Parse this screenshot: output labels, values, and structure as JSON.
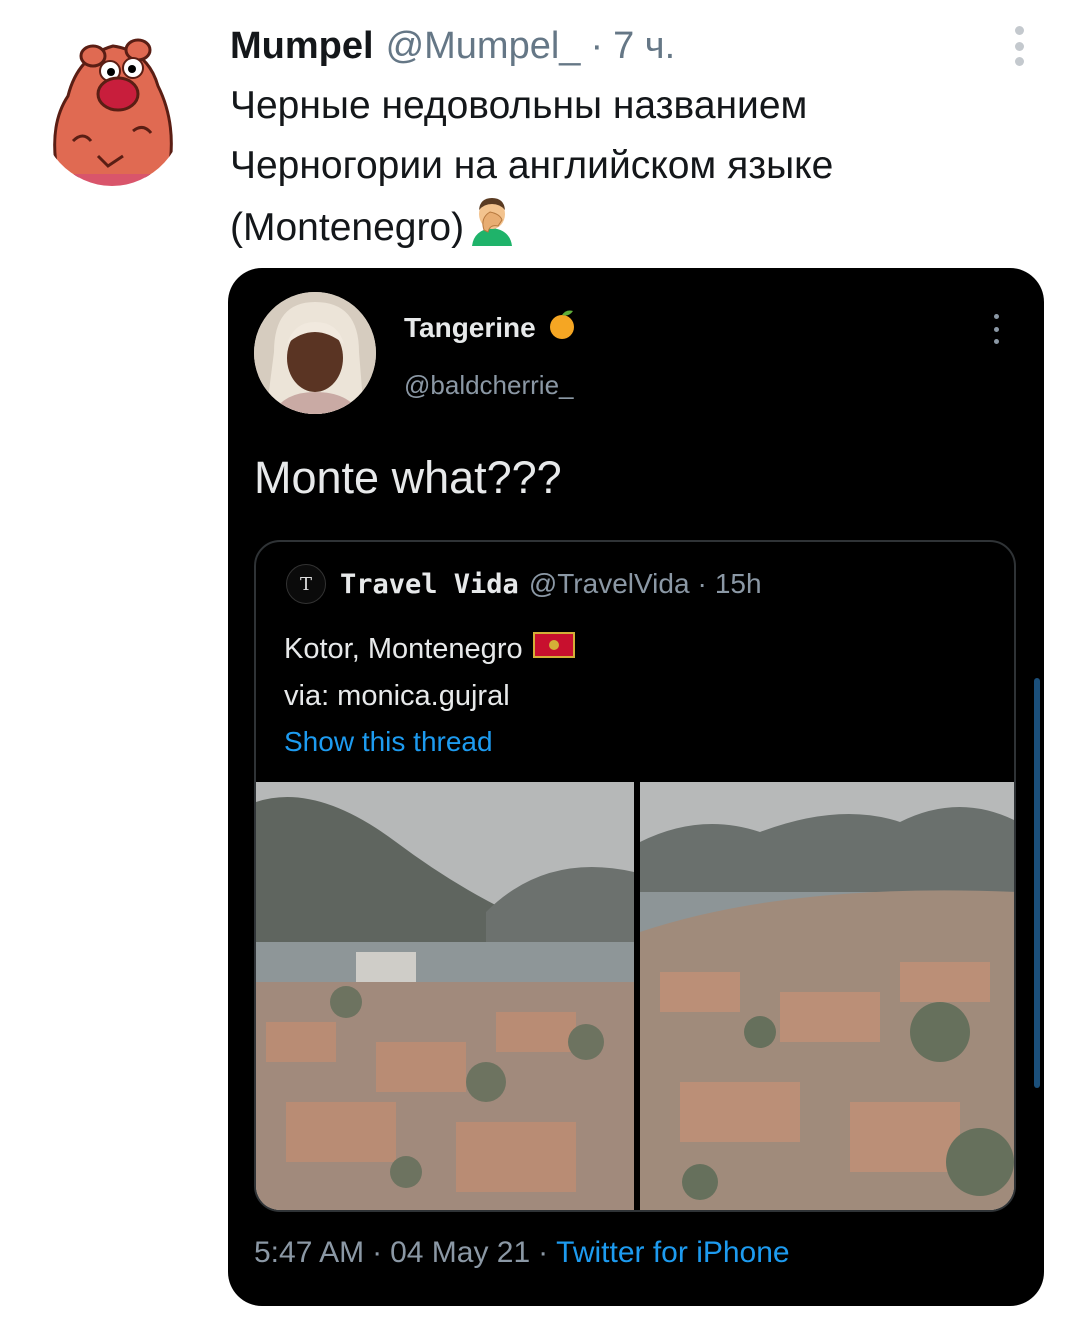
{
  "tweet": {
    "author_name": "Mumpel",
    "author_handle": "@Mumpel_",
    "separator": "·",
    "time_ago": "7 ч.",
    "text_lines": [
      "Черные недовольны названием",
      "Черногории на английском языке",
      "(Montenegro)"
    ],
    "emoji_icon": "facepalm-emoji-icon"
  },
  "embedded": {
    "author_name": "Tangerine",
    "author_handle": "@baldcherrie_",
    "name_icon": "tangerine-emoji-icon",
    "text": "Monte what???",
    "quote": {
      "avatar_letter": "T",
      "author_name": "Travel Vida",
      "author_handle": "@TravelVida",
      "separator": "·",
      "time": "15h",
      "line1": "Kotor, Montenegro",
      "flag_icon": "montenegro-flag-icon",
      "line2": "via: monica.gujral",
      "show_thread": "Show this thread"
    },
    "footer": {
      "time": "5:47 AM",
      "separator": "·",
      "date": "04 May 21",
      "source": "Twitter for iPhone"
    }
  },
  "colors": {
    "link": "#1d9bf0",
    "muted": "#657786",
    "dark_bg": "#000000"
  }
}
